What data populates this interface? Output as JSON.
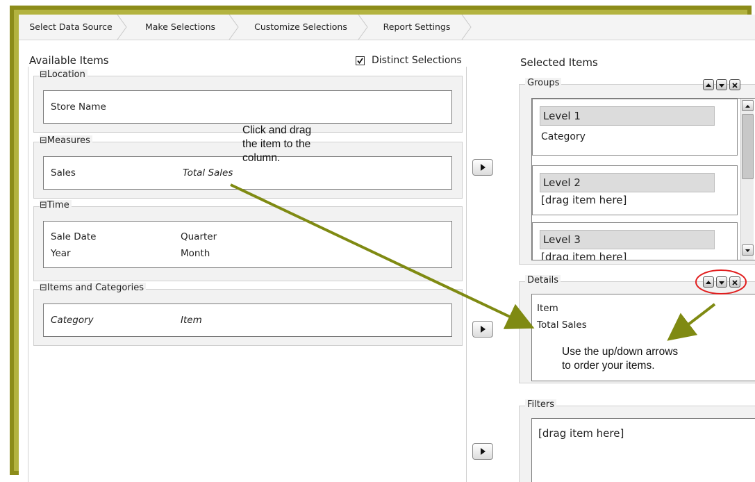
{
  "tabs": [
    {
      "label": "Select Data Source"
    },
    {
      "label": "Make Selections"
    },
    {
      "label": "Customize Selections"
    },
    {
      "label": "Report Settings"
    }
  ],
  "available": {
    "title": "Available Items",
    "distinct_label": "Distinct Selections",
    "distinct_checked": true,
    "groups": {
      "location": {
        "title": "⊟Location",
        "items": [
          "Store Name"
        ]
      },
      "measures": {
        "title": "⊟Measures",
        "items": [
          "Sales",
          "Total Sales"
        ]
      },
      "time": {
        "title": "⊟Time",
        "items": [
          "Sale Date",
          "Quarter",
          "Year",
          "Month"
        ]
      },
      "items_categories": {
        "title": "⊟Items and Categories",
        "items": [
          "Category",
          "Item"
        ]
      }
    }
  },
  "selected": {
    "title": "Selected Items",
    "groups": {
      "title": "Groups",
      "levels": [
        {
          "name": "Level 1",
          "value": "Category"
        },
        {
          "name": "Level 2",
          "value": "[drag item here]"
        },
        {
          "name": "Level 3",
          "value": "[drag item here]"
        }
      ]
    },
    "details": {
      "title": "Details",
      "items": [
        "Item",
        "Total Sales"
      ]
    },
    "filters": {
      "title": "Filters",
      "placeholder": "[drag item here]"
    }
  },
  "annotations": {
    "drag_line1": "Click and drag",
    "drag_line2": "the item to the",
    "drag_line3": "column.",
    "order_line1": "Use the up/down arrows",
    "order_line2": "to order your items."
  },
  "icons": [
    "checkbox-icon",
    "move-right-icon",
    "move-up-icon",
    "move-down-icon",
    "remove-icon",
    "scroll-up-icon",
    "scroll-down-icon"
  ],
  "colors": {
    "annotation_arrow": "#7f8a12",
    "frame_olive": "#8c8c1a",
    "highlight_circle": "#e11d1d"
  }
}
